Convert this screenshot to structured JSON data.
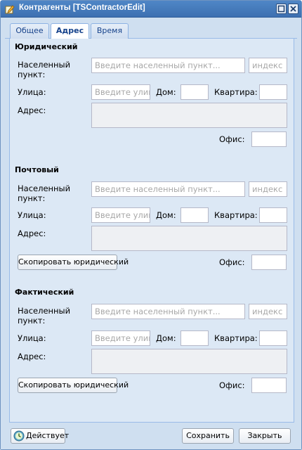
{
  "window": {
    "title": "Контрагенты [TSContractorEdit]",
    "max_icon": "maximize-icon",
    "close_icon": "close-icon"
  },
  "tabs": [
    {
      "label": "Общее",
      "active": false
    },
    {
      "label": "Адрес",
      "active": true
    },
    {
      "label": "Время",
      "active": false
    }
  ],
  "labels": {
    "locality": "Населенный пункт:",
    "street": "Улица:",
    "house": "Дом:",
    "apartment": "Квартира:",
    "address": "Адрес:",
    "office": "Офис:"
  },
  "placeholders": {
    "locality": "Введите населенный пункт...",
    "index": "индекс",
    "street": "Введите улиц"
  },
  "sections": {
    "legal": {
      "title": "Юридический"
    },
    "postal": {
      "title": "Почтовый",
      "copy_button": "Скопировать юридический"
    },
    "actual": {
      "title": "Фактический",
      "copy_button": "Скопировать юридический"
    }
  },
  "footer": {
    "status_label": "Действует",
    "status_icon": "clock-icon",
    "save_label": "Сохранить",
    "close_label": "Закрыть"
  },
  "colors": {
    "titlebar": "#3d70b1",
    "panel": "#dce8f5",
    "tab_text": "#15428b"
  }
}
